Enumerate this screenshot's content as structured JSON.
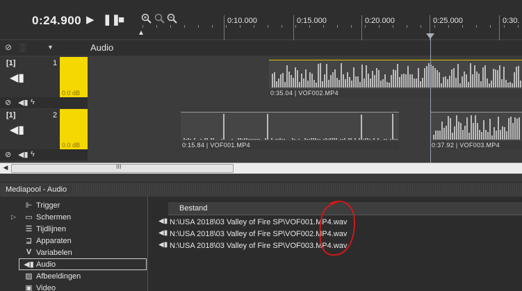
{
  "transport": {
    "time": "0:24.900",
    "play_icon": "play-icon",
    "pause_icon": "pause-icon",
    "stop_icon": "stop-icon"
  },
  "ruler": {
    "ticks": [
      "0:10.000",
      "0:15.000",
      "0:20.000",
      "0:25.000",
      "0:30."
    ]
  },
  "audio_header": {
    "label": "Audio"
  },
  "tracks": [
    {
      "badge": "[1]",
      "number": "1",
      "gain": "0.0 dB",
      "clips": [
        {
          "label": "0:35.04 | VOF002.MP4"
        }
      ]
    },
    {
      "badge": "[1]",
      "number": "2",
      "gain": "0.0 dB",
      "clips": [
        {
          "label": "0:15.84 | VOF001.MP4"
        },
        {
          "label": "0:37.92 | VOF003.MP4"
        }
      ]
    }
  ],
  "scrollbar": {
    "grip": "III"
  },
  "mediapool": {
    "title": "Mediapool - Audio",
    "tree": [
      {
        "label": "Trigger",
        "icon": "trigger-icon"
      },
      {
        "label": "Schermen",
        "icon": "screens-icon",
        "expander": "▷"
      },
      {
        "label": "Tijdlijnen",
        "icon": "timelines-icon"
      },
      {
        "label": "Apparaten",
        "icon": "devices-icon"
      },
      {
        "label": "Variabelen",
        "icon": "variables-icon"
      },
      {
        "label": "Audio",
        "icon": "audio-icon",
        "selected": true
      },
      {
        "label": "Afbeeldingen",
        "icon": "images-icon"
      },
      {
        "label": "Video",
        "icon": "video-icon"
      }
    ],
    "column_header": "Bestand",
    "files": [
      "N:\\USA 2018\\03 Valley of Fire SP\\VOF001.MP4.wav",
      "N:\\USA 2018\\03 Valley of Fire SP\\VOF002.MP4.wav",
      "N:\\USA 2018\\03 Valley of Fire SP\\VOF003.MP4.wav"
    ]
  },
  "colors": {
    "gain_box": "#f5d800",
    "annotation": "#d01818"
  }
}
